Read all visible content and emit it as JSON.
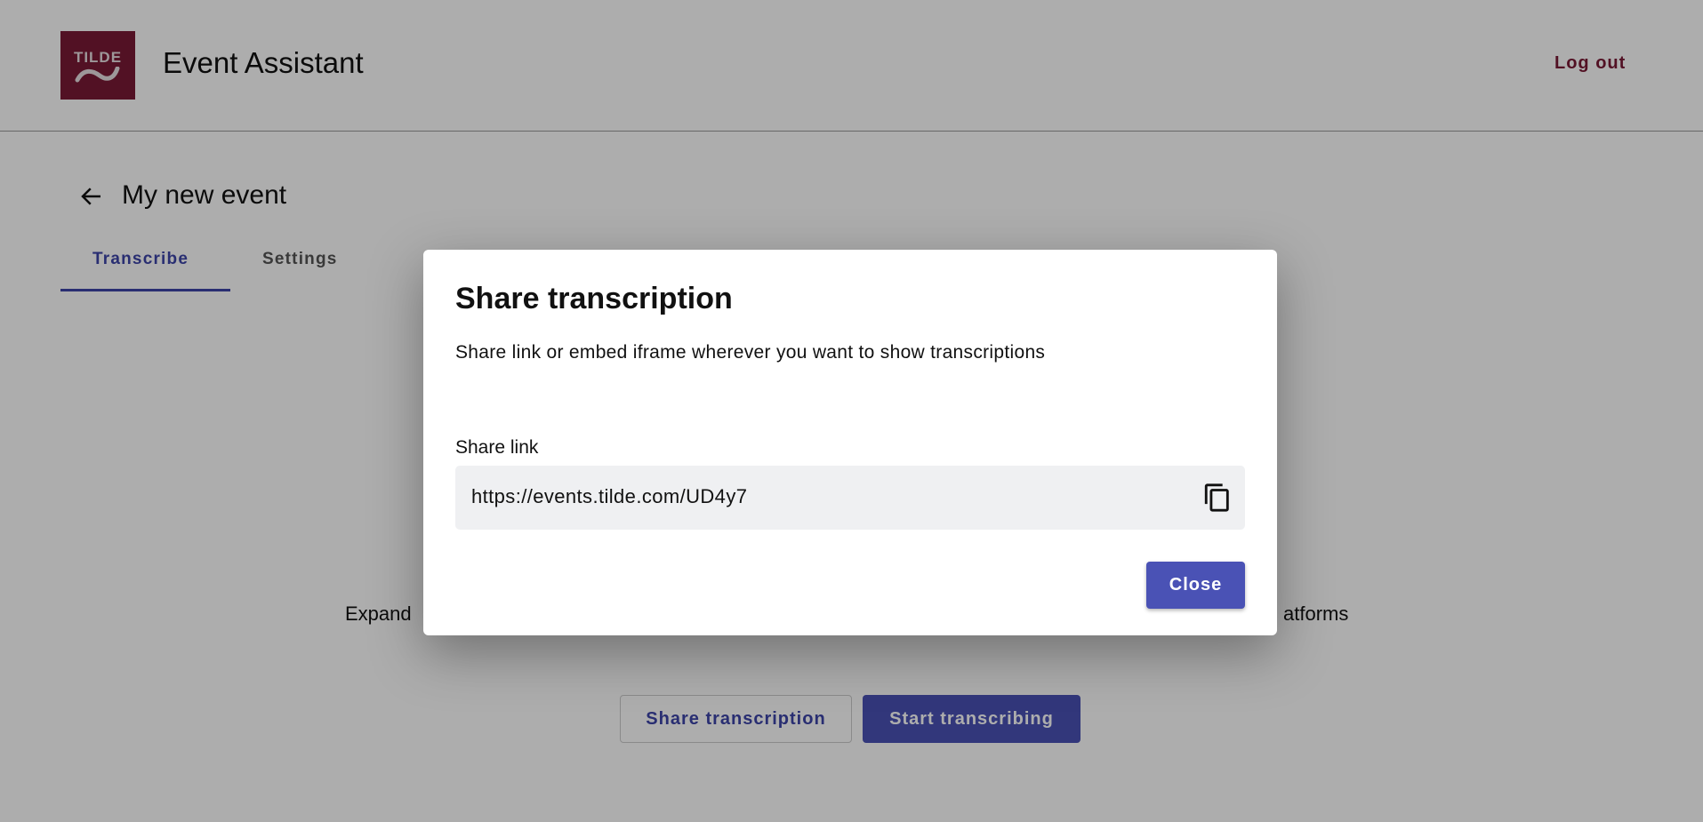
{
  "header": {
    "logo_text": "TILDE",
    "title": "Event Assistant",
    "logout_label": "Log out"
  },
  "event": {
    "title": "My new event"
  },
  "tabs": [
    {
      "label": "Transcribe",
      "active": true
    },
    {
      "label": "Settings",
      "active": false
    }
  ],
  "background": {
    "text_left": "Expand",
    "text_right": "atforms",
    "share_button": "Share transcription",
    "start_button": "Start transcribing"
  },
  "dialog": {
    "title": "Share transcription",
    "subtitle": "Share link or embed iframe wherever you want to show transcriptions",
    "link_label": "Share link",
    "link_value": "https://events.tilde.com/UD4y7",
    "copy_icon": "copy-icon",
    "close_label": "Close"
  },
  "colors": {
    "brand": "#7a1a35",
    "accent": "#4a52b5",
    "overlay": "rgba(0,0,0,0.32)"
  }
}
